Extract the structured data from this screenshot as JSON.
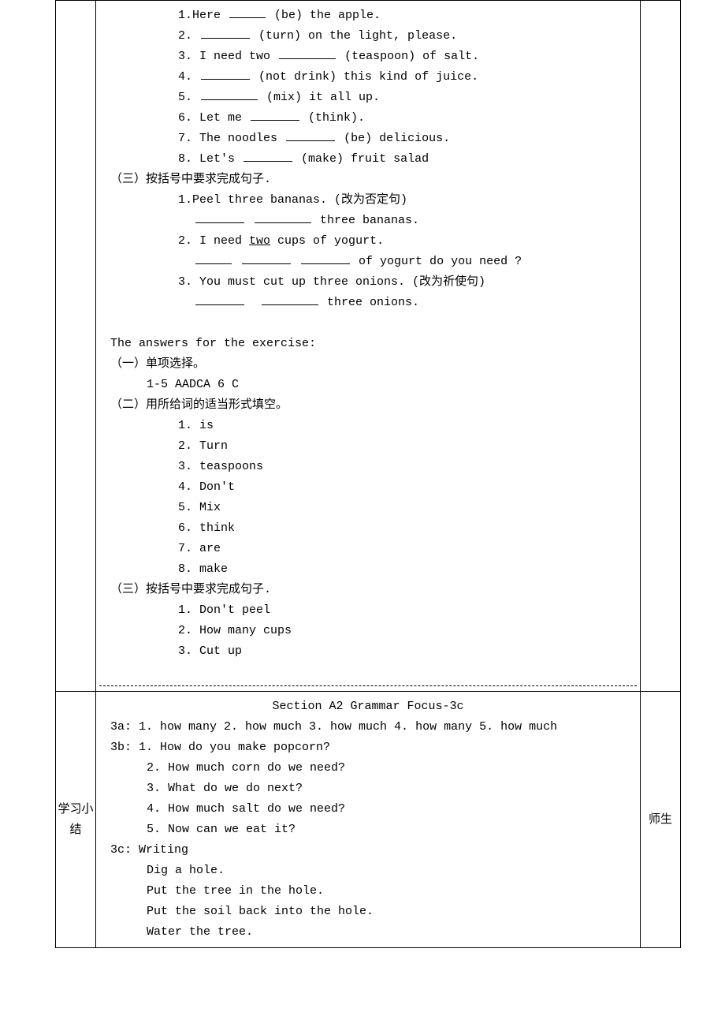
{
  "row1": {
    "left": "",
    "right": "",
    "lines": {
      "l1a": "1.Here ",
      "l1b": "(be) the apple.",
      "l2a": "2. ",
      "l2b": " (turn) on the light, please.",
      "l3a": "3. I need two",
      "l3b": "(teaspoon) of salt.",
      "l4a": "4. ",
      "l4b": "(not drink) this kind of juice.",
      "l5a": "5. ",
      "l5b": "(mix) it all up.",
      "l6a": "6. Let me ",
      "l6b": "(think).",
      "l7a": "7. The noodles",
      "l7b": "(be) delicious.",
      "l8a": "8. Let's",
      "l8b": "(make) fruit salad",
      "h3": "（三）按括号中要求完成句子.",
      "q31": "1.Peel three bananas. (改为否定句)",
      "q31b": "three bananas.",
      "q32": "2. I need ",
      "q32u": "two",
      "q32c": " cups of yogurt.",
      "q32b": "of yogurt do you need ?",
      "q33": "3. You must cut up three onions. (改为祈使句)",
      "q33b": " three onions.",
      "ansTitle": "The answers for the exercise:",
      "ans1h": "（一）单项选择。",
      "ans1": "1-5 AADCA 6 C",
      "ans2h": "（二）用所给词的适当形式填空。",
      "a21": "1. is",
      "a22": "2. Turn",
      "a23": "3. teaspoons",
      "a24": "4. Don't",
      "a25": "5. Mix",
      "a26": "6. think",
      "a27": "7. are",
      "a28": "8. make",
      "ans3h": "（三）按括号中要求完成句子.",
      "a31": "1. Don't    peel",
      "a32": "2. How    many    cups",
      "a33": "3. Cut        up"
    }
  },
  "row2": {
    "left": "学习小结",
    "right": "师生",
    "title": "Section A2 Grammar Focus-3c",
    "lines": {
      "l3a": "3a:  1. how many  2. how much 3. how much  4. how many 5. how much",
      "l3b": "3b: 1. How do you make popcorn?",
      "b2": "2. How much corn do we need?",
      "b3": "3. What do we do next?",
      "b4": "4. How much salt do we need?",
      "b5": "5. Now can we eat it?",
      "l3c": "3c: Writing",
      "c1": "Dig a hole.",
      "c2": "Put the tree in the hole.",
      "c3": "Put the soil back into the hole.",
      "c4": "Water the tree."
    }
  }
}
